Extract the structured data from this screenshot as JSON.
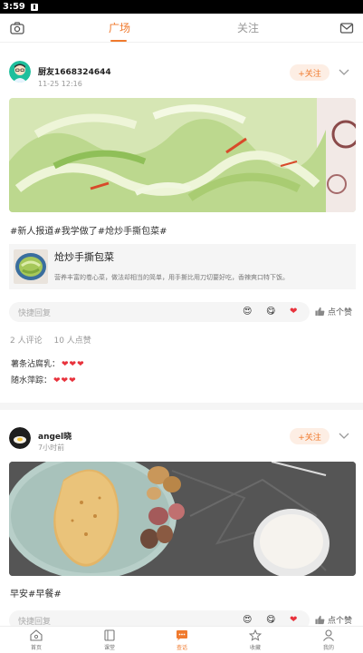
{
  "status_bar": {
    "time": "3:59"
  },
  "top_nav": {
    "tabs": [
      {
        "label": "广场",
        "active": true
      },
      {
        "label": "关注",
        "active": false
      }
    ]
  },
  "posts": [
    {
      "author": "厨友1668324644",
      "time": "11-25 12:16",
      "follow_label": "+关注",
      "photo_icon": "stir-fried-cabbage-photo",
      "tags": "#新人报道#我学做了#炝炒手撕包菜#",
      "recipe": {
        "title": "炝炒手撕包菜",
        "desc": "营养丰富的卷心菜，做法却相当的简单，用手撕比用刀切要好吃，香辣爽口特下饭。"
      },
      "reply_placeholder": "快捷回复",
      "emojis": [
        "😍",
        "😋",
        "❤"
      ],
      "like_label": "点个赞",
      "stats": {
        "comments": "2 人评论",
        "likes": "10 人点赞"
      },
      "comments": [
        {
          "user": "薯条沾腐乳：",
          "hearts": "❤❤❤"
        },
        {
          "user": "随水萍踪：",
          "hearts": "❤❤❤"
        }
      ]
    },
    {
      "author": "angel晓",
      "time": "7小时前",
      "follow_label": "+关注",
      "photo_icon": "breakfast-toast-walnut-milk-photo",
      "tags": "早安#早餐#",
      "reply_placeholder": "快捷回复",
      "emojis": [
        "😍",
        "😋",
        "❤"
      ],
      "like_label": "点个赞"
    }
  ],
  "bottom_nav": {
    "items": [
      {
        "label": "首页",
        "icon": "home-icon"
      },
      {
        "label": "课堂",
        "icon": "book-icon"
      },
      {
        "label": "查话",
        "icon": "chat-icon",
        "active": true
      },
      {
        "label": "收藏",
        "icon": "star-icon"
      },
      {
        "label": "我的",
        "icon": "user-icon"
      }
    ]
  },
  "colors": {
    "accent": "#f07a2e",
    "heart": "#e8323c",
    "card_bg": "#f5f5f5"
  }
}
